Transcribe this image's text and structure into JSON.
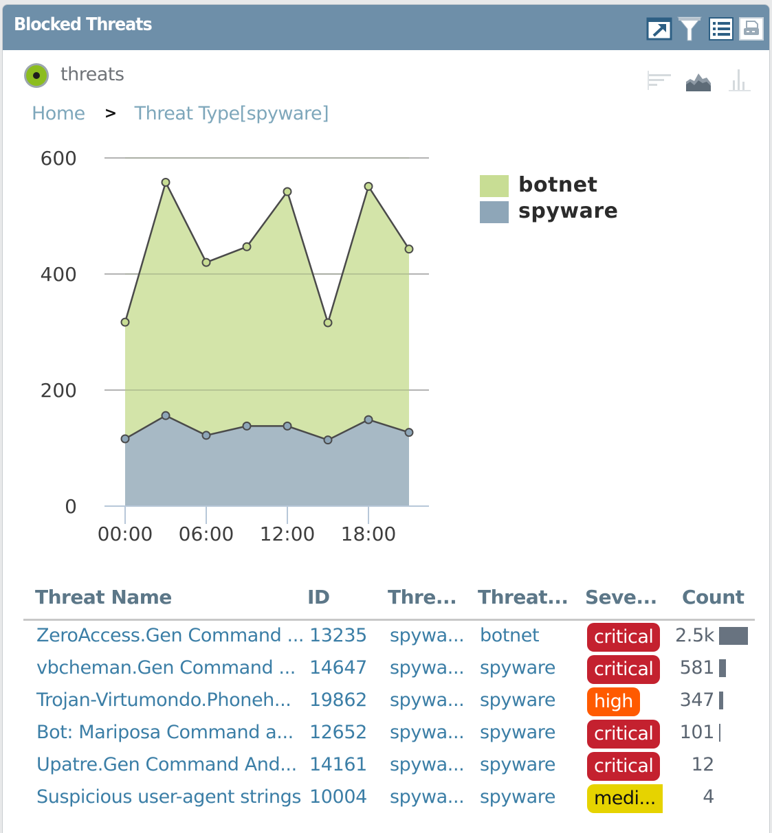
{
  "panel": {
    "title": "Blocked Threats",
    "header_buttons": [
      {
        "name": "expand-icon",
        "label": "Open in new view"
      },
      {
        "name": "filter-icon",
        "label": "Filter"
      },
      {
        "name": "list-view-icon",
        "label": "Table view"
      },
      {
        "name": "print-icon",
        "label": "Print"
      }
    ]
  },
  "widget": {
    "status": "active",
    "name": "threats",
    "chart_types": [
      {
        "name": "bar-chart-horizontal-icon",
        "active": false
      },
      {
        "name": "area-chart-icon",
        "active": true
      },
      {
        "name": "bar-chart-vertical-icon",
        "active": false
      }
    ]
  },
  "breadcrumb": {
    "items": [
      "Home",
      "Threat Type[spyware]"
    ],
    "separator": ">"
  },
  "colors": {
    "header_bg": "#6e8fa9",
    "botnet": "#c8dd94",
    "spyware": "#8ea6b8",
    "link": "#3b7ea6",
    "critical": "#c4212f",
    "high": "#ff5a00",
    "medium": "#e6d300"
  },
  "chart_data": {
    "type": "area",
    "stacked": true,
    "title": "",
    "xlabel": "",
    "ylabel": "",
    "x": [
      "00:00",
      "03:00",
      "06:00",
      "09:00",
      "12:00",
      "15:00",
      "18:00",
      "21:00"
    ],
    "x_tick_labels": [
      "00:00",
      "06:00",
      "12:00",
      "18:00"
    ],
    "y_tick_labels": [
      "0",
      "200",
      "400",
      "600"
    ],
    "ylim": [
      0,
      600
    ],
    "grid": true,
    "legend": "top-right",
    "series": [
      {
        "name": "spyware",
        "color": "#8ea6b8",
        "values": [
          116,
          156,
          122,
          138,
          138,
          114,
          149,
          127
        ]
      },
      {
        "name": "botnet",
        "color": "#c8dd94",
        "values": [
          201,
          402,
          298,
          309,
          404,
          202,
          402,
          316
        ]
      }
    ],
    "legend_order": [
      "botnet",
      "spyware"
    ]
  },
  "table": {
    "columns": [
      "Threat Name",
      "ID",
      "Thre...",
      "Threat...",
      "Seve...",
      "Count"
    ],
    "rows": [
      {
        "name": "ZeroAccess.Gen Command ...",
        "id": "13235",
        "category": "spywa...",
        "type": "botnet",
        "severity": "critical",
        "severity_label": "critical",
        "count": "2.5k",
        "count_value": 2500
      },
      {
        "name": "vbcheman.Gen Command ...",
        "id": "14647",
        "category": "spywa...",
        "type": "spyware",
        "severity": "critical",
        "severity_label": "critical",
        "count": "581",
        "count_value": 581
      },
      {
        "name": "Trojan-Virtumondo.Phoneh...",
        "id": "19862",
        "category": "spywa...",
        "type": "spyware",
        "severity": "high",
        "severity_label": "high",
        "count": "347",
        "count_value": 347
      },
      {
        "name": "Bot: Mariposa Command a...",
        "id": "12652",
        "category": "spywa...",
        "type": "spyware",
        "severity": "critical",
        "severity_label": "critical",
        "count": "101",
        "count_value": 101
      },
      {
        "name": "Upatre.Gen Command And...",
        "id": "14161",
        "category": "spywa...",
        "type": "spyware",
        "severity": "critical",
        "severity_label": "critical",
        "count": "12",
        "count_value": 12
      },
      {
        "name": "Suspicious user-agent strings",
        "id": "10004",
        "category": "spywa...",
        "type": "spyware",
        "severity": "medium",
        "severity_label": "medi...",
        "count": "4",
        "count_value": 4
      }
    ]
  }
}
